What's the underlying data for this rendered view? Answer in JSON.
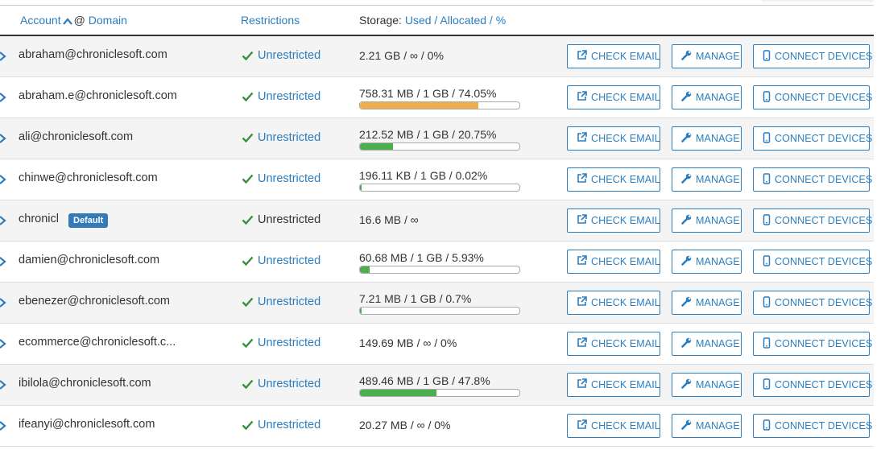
{
  "colors": {
    "link": "#2a7ec0",
    "check": "#3c8f3c",
    "bar_orange": "#f0ad4e",
    "bar_green": "#4cae4c",
    "badge": "#337ab7"
  },
  "header": {
    "account": "Account",
    "at": "@",
    "domain": "Domain",
    "restrictions": "Restrictions",
    "storage_label": "Storage:",
    "used": "Used",
    "sep1": "/",
    "allocated": "Allocated",
    "sep2": "/",
    "percent": "%",
    "sort_icon": "caret-up-icon"
  },
  "buttons": {
    "check_email": "CHECK EMAIL",
    "manage": "MANAGE",
    "connect_devices": "CONNECT DEVICES"
  },
  "rows": [
    {
      "account": "abraham@chronicles oft.com",
      "badge": "",
      "restriction": "Unrestricted",
      "restriction_link": true,
      "storage": "2.21 GB / ∞ / 0%",
      "usage_fraction": null,
      "bar_color": ""
    },
    {
      "account": "abraham.e@chroniclesoft.com",
      "badge": "",
      "restriction": "Unrestricted",
      "restriction_link": true,
      "storage": "758.31 MB / 1 GB / 74.05%",
      "usage_fraction": 0.7405,
      "bar_color": "#f0ad4e"
    },
    {
      "account": "ali@chroniclesoft.com",
      "badge": "",
      "restriction": "Unrestricted",
      "restriction_link": true,
      "storage": "212.52 MB / 1 GB / 20.75%",
      "usage_fraction": 0.2075,
      "bar_color": "#4cae4c"
    },
    {
      "account": "chinwe@chroniclesoft.com",
      "badge": "",
      "restriction": "Unrestricted",
      "restriction_link": true,
      "storage": "196.11 KB / 1 GB / 0.02%",
      "usage_fraction": 0.0002,
      "bar_color": "#4cae4c"
    },
    {
      "account": "chronicl",
      "badge": "Default",
      "restriction": "Unrestricted",
      "restriction_link": false,
      "storage": "16.6 MB / ∞",
      "usage_fraction": null,
      "bar_color": ""
    },
    {
      "account": "damien@chroniclesoft.com",
      "badge": "",
      "restriction": "Unrestricted",
      "restriction_link": true,
      "storage": "60.68 MB / 1 GB / 5.93%",
      "usage_fraction": 0.0593,
      "bar_color": "#4cae4c"
    },
    {
      "account": "ebenezer@chroniclesoft.com",
      "badge": "",
      "restriction": "Unrestricted",
      "restriction_link": true,
      "storage": "7.21 MB / 1 GB / 0.7%",
      "usage_fraction": 0.007,
      "bar_color": "#4cae4c"
    },
    {
      "account": "ecommerce@chroniclesoft.c...",
      "badge": "",
      "restriction": "Unrestricted",
      "restriction_link": true,
      "storage": "149.69 MB / ∞ / 0%",
      "usage_fraction": null,
      "bar_color": ""
    },
    {
      "account": "ibilola@chroniclesoft.com",
      "badge": "",
      "restriction": "Unrestricted",
      "restriction_link": true,
      "storage": "489.46 MB / 1 GB / 47.8%",
      "usage_fraction": 0.478,
      "bar_color": "#4cae4c"
    },
    {
      "account": "ifeanyi@chroniclesoft.com",
      "badge": "",
      "restriction": "Unrestricted",
      "restriction_link": true,
      "storage": "20.27 MB / ∞ / 0%",
      "usage_fraction": null,
      "bar_color": ""
    }
  ]
}
